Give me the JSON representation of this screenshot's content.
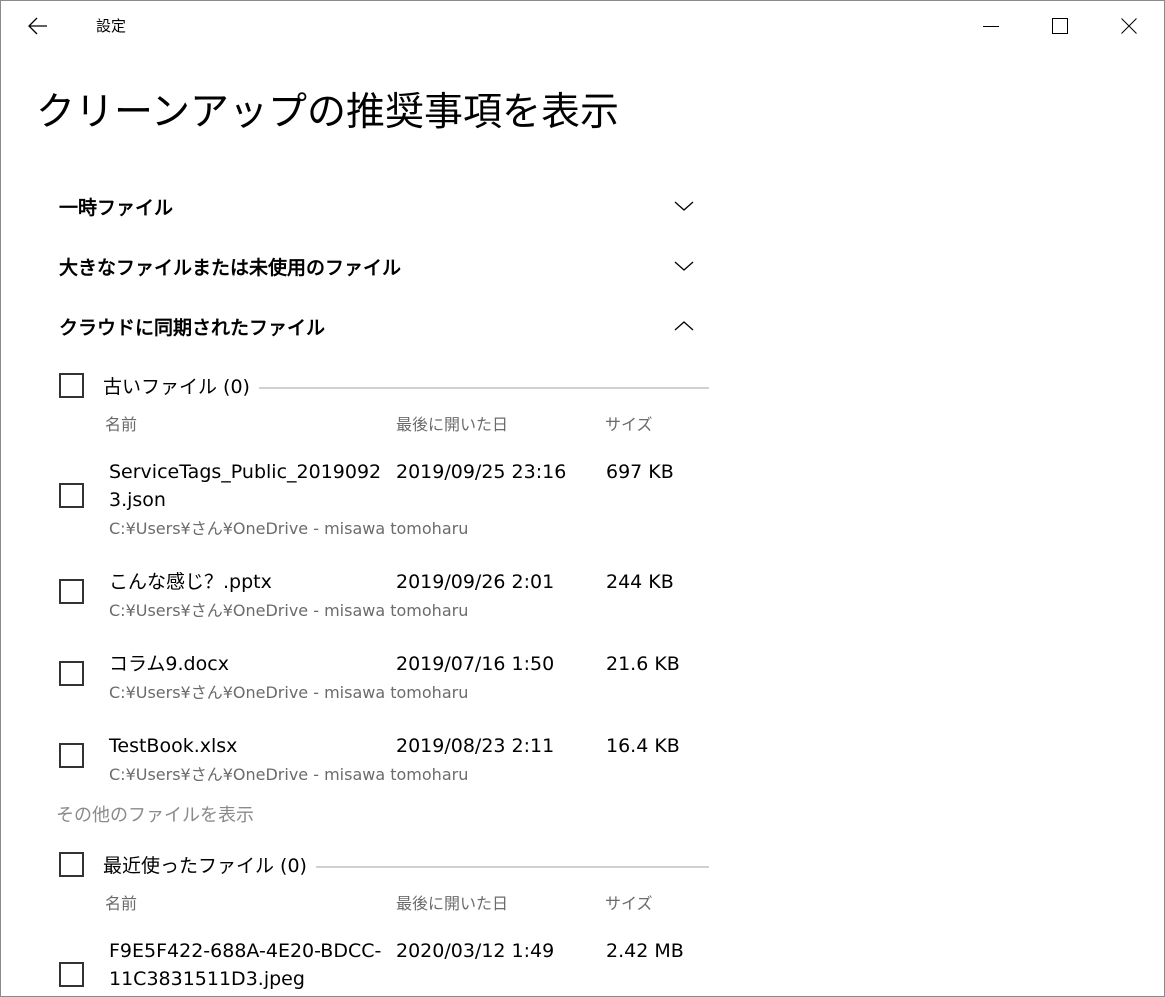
{
  "window": {
    "title": "設定"
  },
  "page": {
    "title": "クリーンアップの推奨事項を表示"
  },
  "sections": [
    {
      "label": "一時ファイル",
      "expanded": false
    },
    {
      "label": "大きなファイルまたは未使用のファイル",
      "expanded": false
    },
    {
      "label": "クラウドに同期されたファイル",
      "expanded": true
    }
  ],
  "groups": {
    "old_files": {
      "label": "古いファイル (0)",
      "columns": {
        "name": "名前",
        "date": "最後に開いた日",
        "size": "サイズ"
      },
      "rows": [
        {
          "name": "ServiceTags_Public_20190923.json",
          "path": "C:¥Users¥さん¥OneDrive - misawa tomoharu",
          "date": "2019/09/25 23:16",
          "size": "697 KB"
        },
        {
          "name": "こんな感じ？.pptx",
          "path": "C:¥Users¥さん¥OneDrive - misawa tomoharu",
          "date": "2019/09/26 2:01",
          "size": "244 KB"
        },
        {
          "name": "コラム9.docx",
          "path": "C:¥Users¥さん¥OneDrive - misawa tomoharu",
          "date": "2019/07/16 1:50",
          "size": "21.6 KB"
        },
        {
          "name": "TestBook.xlsx",
          "path": "C:¥Users¥さん¥OneDrive - misawa tomoharu",
          "date": "2019/08/23 2:11",
          "size": "16.4 KB"
        }
      ],
      "more_link": "その他のファイルを表示"
    },
    "recent_files": {
      "label": "最近使ったファイル (0)",
      "columns": {
        "name": "名前",
        "date": "最後に開いた日",
        "size": "サイズ"
      },
      "rows": [
        {
          "name": "F9E5F422-688A-4E20-BDCC-11C3831511D3.jpeg",
          "date": "2020/03/12 1:49",
          "size": "2.42 MB"
        }
      ]
    }
  }
}
